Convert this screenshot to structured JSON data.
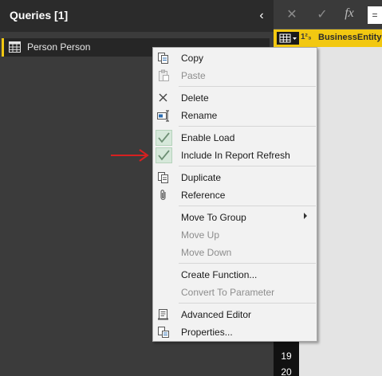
{
  "queries": {
    "title": "Queries [1]",
    "collapse_icon": "‹",
    "items": [
      {
        "label": "Person Person",
        "icon": "table-icon"
      }
    ]
  },
  "formula_bar": {
    "cancel": "✕",
    "confirm": "✓",
    "fx": "fx",
    "equals": "="
  },
  "grid": {
    "column_type": "1²₃",
    "column_name": "BusinessEntityID",
    "row_numbers": [
      "19",
      "20"
    ]
  },
  "context_menu": {
    "items": [
      {
        "label": "Copy",
        "icon": "copy-icon",
        "enabled": true
      },
      {
        "label": "Paste",
        "icon": "paste-icon",
        "enabled": false
      },
      {
        "label": "Delete",
        "icon": "delete-icon",
        "enabled": true
      },
      {
        "label": "Rename",
        "icon": "rename-icon",
        "enabled": true
      },
      {
        "label": "Enable Load",
        "icon": "checked-icon",
        "enabled": true,
        "checked": true
      },
      {
        "label": "Include In Report Refresh",
        "icon": "checked-icon",
        "enabled": true,
        "checked": true
      },
      {
        "label": "Duplicate",
        "icon": "duplicate-icon",
        "enabled": true
      },
      {
        "label": "Reference",
        "icon": "reference-icon",
        "enabled": true
      },
      {
        "label": "Move To Group",
        "enabled": true,
        "has_submenu": true
      },
      {
        "label": "Move Up",
        "enabled": false
      },
      {
        "label": "Move Down",
        "enabled": false
      },
      {
        "label": "Create Function...",
        "enabled": true
      },
      {
        "label": "Convert To Parameter",
        "enabled": false
      },
      {
        "label": "Advanced Editor",
        "icon": "advanced-editor-icon",
        "enabled": true
      },
      {
        "label": "Properties...",
        "icon": "properties-icon",
        "enabled": true
      }
    ]
  },
  "colors": {
    "accent": "#f2c811",
    "annotation_arrow": "#d62020"
  }
}
